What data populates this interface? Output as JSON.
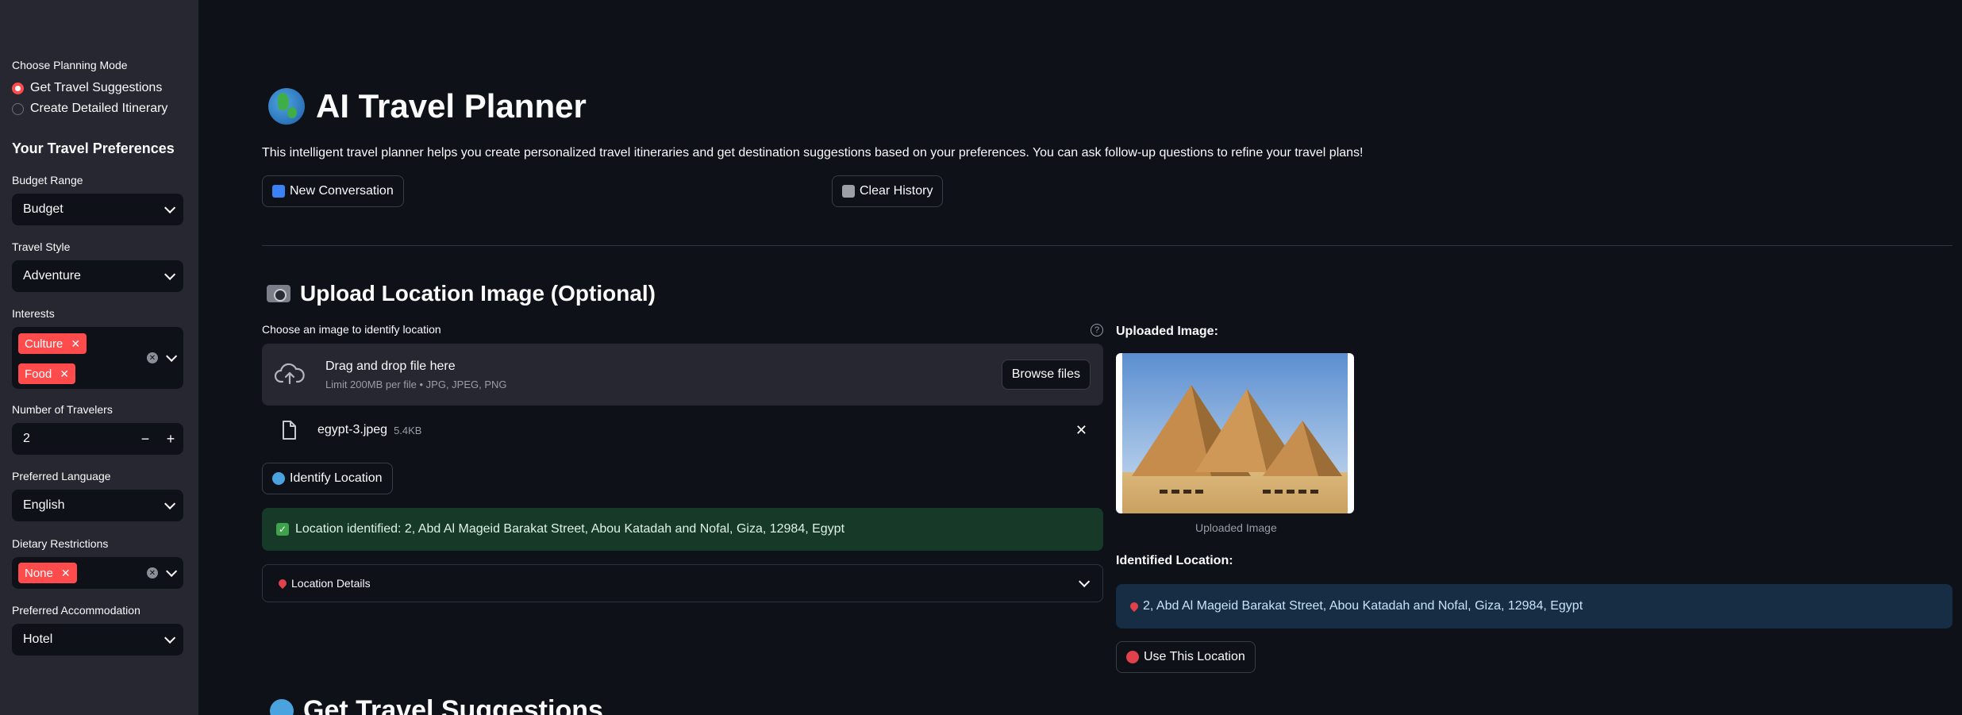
{
  "sidebar": {
    "planning_mode_label": "Choose Planning Mode",
    "planning_modes": [
      {
        "label": "Get Travel Suggestions",
        "selected": true
      },
      {
        "label": "Create Detailed Itinerary",
        "selected": false
      }
    ],
    "preferences_heading": "Your Travel Preferences",
    "budget": {
      "label": "Budget Range",
      "value": "Budget"
    },
    "travel_style": {
      "label": "Travel Style",
      "value": "Adventure"
    },
    "interests": {
      "label": "Interests",
      "tags": [
        "Culture",
        "Food"
      ]
    },
    "travelers": {
      "label": "Number of Travelers",
      "value": "2",
      "minus": "−",
      "plus": "+"
    },
    "language": {
      "label": "Preferred Language",
      "value": "English"
    },
    "dietary": {
      "label": "Dietary Restrictions",
      "tags": [
        "None"
      ]
    },
    "accommodation": {
      "label": "Preferred Accommodation",
      "value": "Hotel"
    }
  },
  "main": {
    "title": "AI Travel Planner",
    "description": "This intelligent travel planner helps you create personalized travel itineraries and get destination suggestions based on your preferences. You can ask follow-up questions to refine your travel plans!",
    "new_conversation_label": "New Conversation",
    "clear_history_label": "Clear History",
    "upload_heading": "Upload Location Image (Optional)",
    "uploader_label": "Choose an image to identify location",
    "help_glyph": "?",
    "dropzone_title": "Drag and drop file here",
    "dropzone_limit": "Limit 200MB per file • JPG, JPEG, PNG",
    "browse_label": "Browse files",
    "file": {
      "name": "egypt-3.jpeg",
      "size": "5.4KB"
    },
    "identify_label": "Identify Location",
    "success_message": "Location identified: 2, Abd Al Mageid Barakat Street, Abou Katadah and Nofal, Giza, 12984, Egypt",
    "location_details_label": "Location Details",
    "uploaded_image_heading": "Uploaded Image:",
    "image_caption": "Uploaded Image",
    "identified_heading": "Identified Location:",
    "identified_value": "2, Abd Al Mageid Barakat Street, Abou Katadah and Nofal, Giza, 12984, Egypt",
    "use_location_label": "Use This Location",
    "next_heading": "Get Travel Suggestions"
  },
  "colors": {
    "accent": "#ff4b4b",
    "background": "#0e1117",
    "sidebar": "#262730",
    "success_bg": "#173928",
    "info_bg": "#172d43"
  }
}
